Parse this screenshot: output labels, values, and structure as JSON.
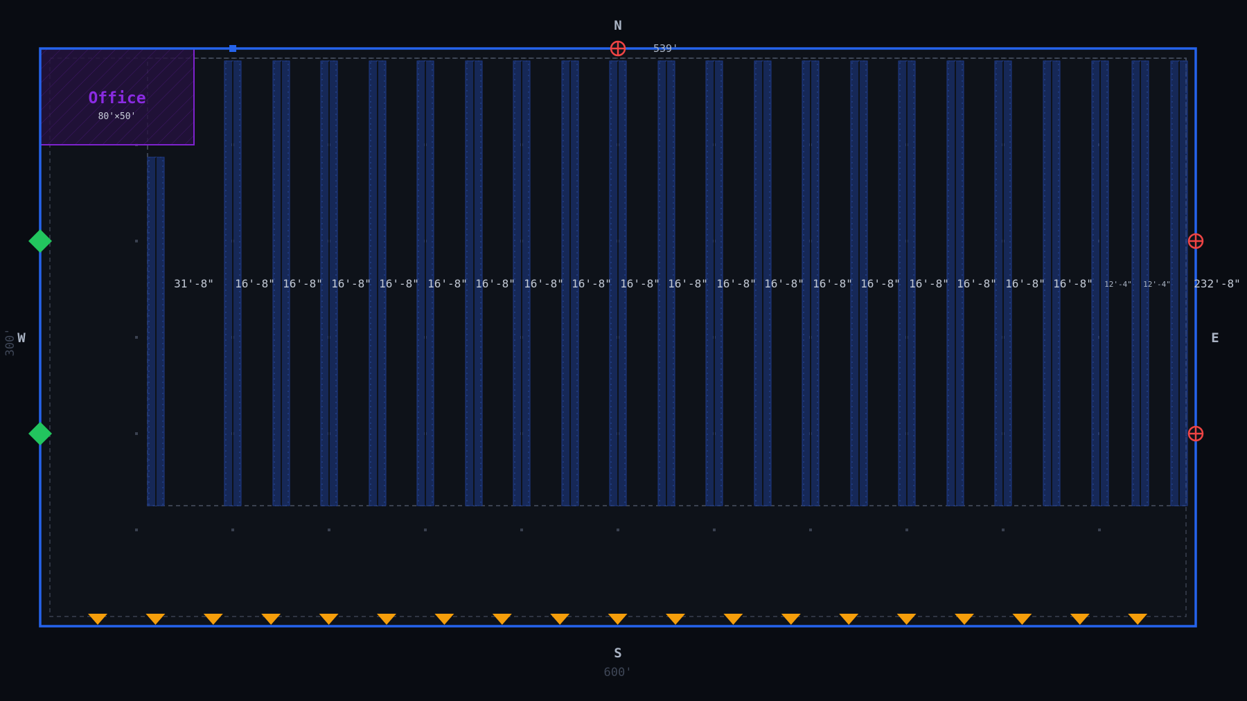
{
  "compass": {
    "north": "N",
    "south": "S",
    "west": "W",
    "east": "E"
  },
  "dimensions": {
    "width": "600'",
    "depth": "300'",
    "north_marker": "539'"
  },
  "office": {
    "name": "Office",
    "size": "80'×50'"
  },
  "bays": {
    "labels": [
      "31'-8\"",
      "16'-8\"",
      "16'-8\"",
      "16'-8\"",
      "16'-8\"",
      "16'-8\"",
      "16'-8\"",
      "16'-8\"",
      "16'-8\"",
      "16'-8\"",
      "16'-8\"",
      "16'-8\"",
      "16'-8\"",
      "16'-8\"",
      "16'-8\"",
      "16'-8\"",
      "16'-8\"",
      "16'-8\"",
      "16'-8\"",
      "12'-4\"",
      "12'-4\"",
      "232'-8\""
    ],
    "small_labels": [
      false,
      false,
      false,
      false,
      false,
      false,
      false,
      false,
      false,
      false,
      false,
      false,
      false,
      false,
      false,
      false,
      false,
      false,
      false,
      true,
      true,
      false
    ]
  },
  "dock_doors": {
    "count": 19
  },
  "colors": {
    "background": "#090c12",
    "floor": "#0e1219",
    "wall": "#2563eb",
    "rack": "#1e3a8a",
    "rack_inner": "#284a9e",
    "office": "#7e22ce",
    "dock_door": "#f59e0b",
    "entry_door": "#22c55e",
    "exit_marker": "#ef4444"
  },
  "icons": {
    "dock_door": "triangle-down-icon",
    "entry_door": "diamond-icon",
    "exit_marker": "circle-cross-icon"
  }
}
